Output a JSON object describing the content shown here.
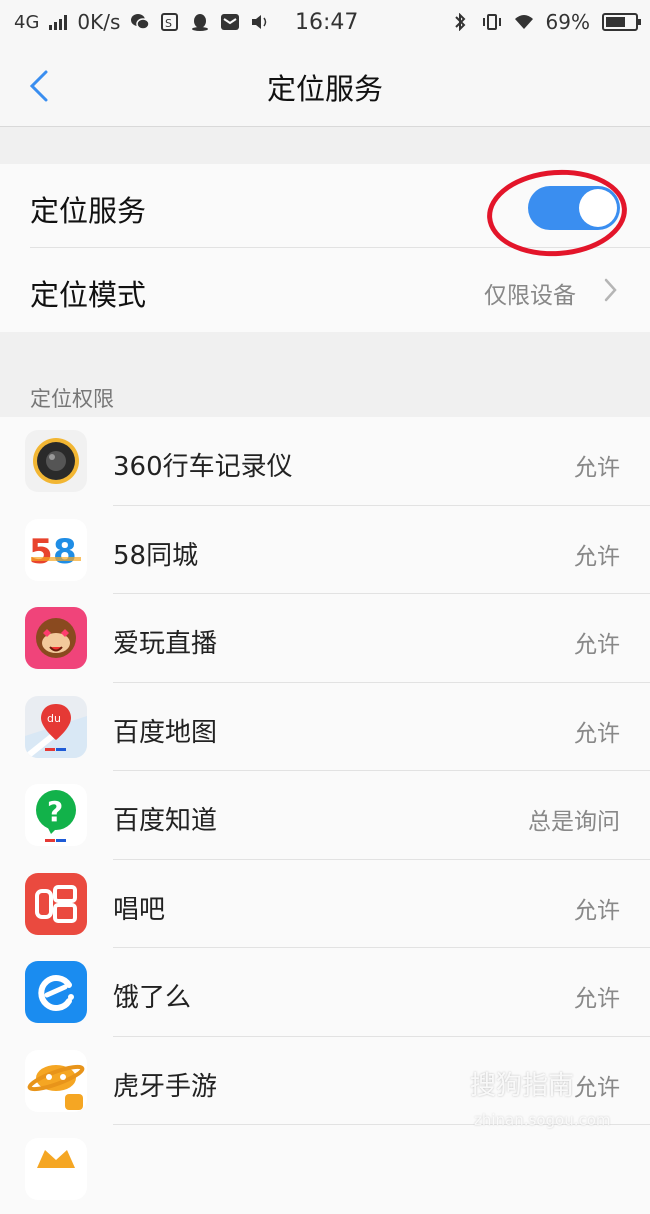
{
  "status_bar": {
    "network": "4G",
    "speed": "0K/s",
    "time": "16:47",
    "battery": "69%",
    "battery_level": 0.69
  },
  "nav": {
    "title": "定位服务"
  },
  "location_service": {
    "label": "定位服务",
    "enabled": true,
    "accent_color": "#3a8ef0",
    "annotation_color": "#e3152a"
  },
  "location_mode": {
    "label": "定位模式",
    "value": "仅限设备"
  },
  "permissions": {
    "header": "定位权限",
    "apps": [
      {
        "name": "360行车记录仪",
        "status": "允许",
        "icon": "dashcam-icon"
      },
      {
        "name": "58同城",
        "status": "允许",
        "icon": "58-logo-icon"
      },
      {
        "name": "爱玩直播",
        "status": "允许",
        "icon": "monkey-icon"
      },
      {
        "name": "百度地图",
        "status": "允许",
        "icon": "map-pin-icon"
      },
      {
        "name": "百度知道",
        "status": "总是询问",
        "icon": "question-icon"
      },
      {
        "name": "唱吧",
        "status": "允许",
        "icon": "changba-icon"
      },
      {
        "name": "饿了么",
        "status": "允许",
        "icon": "eleme-icon"
      },
      {
        "name": "虎牙手游",
        "status": "允许",
        "icon": "huya-icon"
      }
    ]
  },
  "watermark": {
    "text": "搜狗指南",
    "sub": "zhinan.sogou.com"
  }
}
